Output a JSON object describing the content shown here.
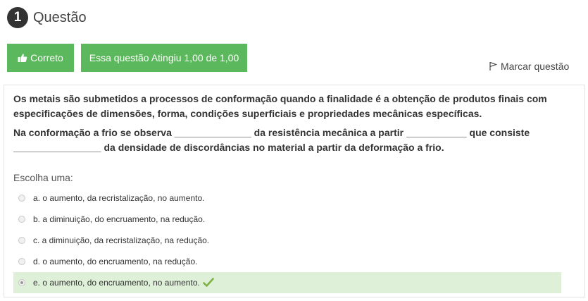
{
  "question": {
    "number": "1",
    "title": "Questão"
  },
  "status": {
    "correct_label": "Correto",
    "score_label": "Essa questão Atingiu 1,00 de 1,00",
    "flag_label": "Marcar questão"
  },
  "text": {
    "paragraph1": "Os metais são submetidos a processos de conformação quando a finalidade é a obtenção de produtos finais com especificações de dimensões, forma, condições superficiais e propriedades mecânicas específicas.",
    "paragraph2": "Na conformação a frio se observa ______________ da resistência mecânica a partir ___________ que consiste ________________ da densidade de discordâncias no material a partir da deformação a frio."
  },
  "answers": {
    "prompt": "Escolha uma:",
    "options": [
      {
        "label": "a. o aumento, da recristalização, no aumento.",
        "selected": false
      },
      {
        "label": "b. a diminuição, do encruamento, na redução.",
        "selected": false
      },
      {
        "label": "c. a diminuição, da recristalização, na redução.",
        "selected": false
      },
      {
        "label": "d. o aumento, do encruamento, na redução.",
        "selected": false
      },
      {
        "label": "e. o aumento, do encruamento, no aumento.",
        "selected": true,
        "correct": true
      }
    ]
  },
  "colors": {
    "success": "#5cb85c",
    "correct_bg": "#dff0d8",
    "check": "#7cb342"
  },
  "icons": [
    "thumbs-up-icon",
    "flag-icon",
    "checkmark-icon"
  ]
}
